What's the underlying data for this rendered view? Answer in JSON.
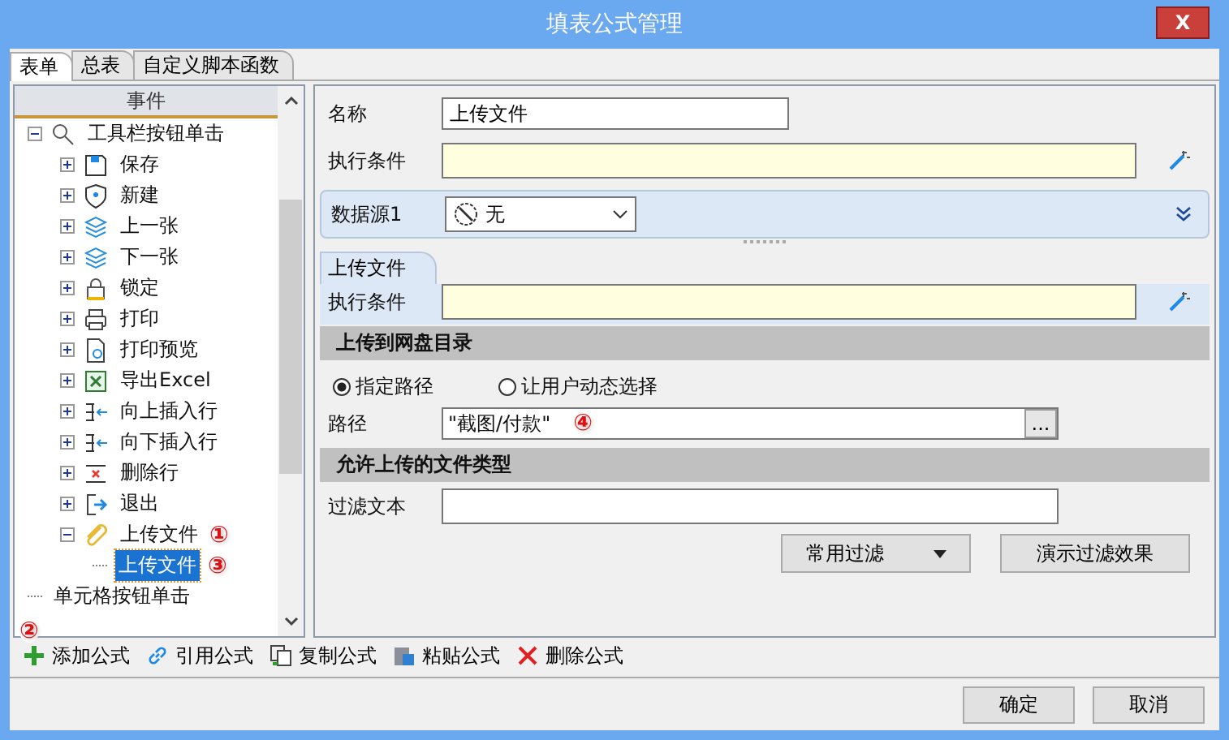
{
  "window": {
    "title": "填表公式管理",
    "close": "X"
  },
  "tabs": [
    {
      "label": "表单",
      "selected": true
    },
    {
      "label": "总表",
      "selected": false
    },
    {
      "label": "自定义脚本函数",
      "selected": false
    }
  ],
  "tree": {
    "header": "事件",
    "items": [
      {
        "label": "工具栏按钮单击",
        "expanded": true,
        "selected": false,
        "children": [
          {
            "label": "保存",
            "expanded": false,
            "selected": false
          },
          {
            "label": "新建",
            "expanded": false,
            "selected": false
          },
          {
            "label": "上一张",
            "expanded": false,
            "selected": false
          },
          {
            "label": "下一张",
            "expanded": false,
            "selected": false
          },
          {
            "label": "锁定",
            "expanded": false,
            "selected": false
          },
          {
            "label": "打印",
            "expanded": false,
            "selected": false
          },
          {
            "label": "打印预览",
            "expanded": false,
            "selected": false
          },
          {
            "label": "导出Excel",
            "expanded": false,
            "selected": false
          },
          {
            "label": "向上插入行",
            "expanded": false,
            "selected": false
          },
          {
            "label": "向下插入行",
            "expanded": false,
            "selected": false
          },
          {
            "label": "删除行",
            "expanded": false,
            "selected": false
          },
          {
            "label": "退出",
            "expanded": false,
            "selected": false
          },
          {
            "label": "上传文件",
            "expanded": true,
            "selected": false,
            "badge": "①",
            "children": [
              {
                "label": "上传文件",
                "selected": true,
                "badge": "③"
              }
            ]
          }
        ]
      },
      {
        "label": "单元格按钮单击",
        "selected": false
      }
    ]
  },
  "form": {
    "name_label": "名称",
    "name_value": "上传文件",
    "condition_label": "执行条件",
    "datasource": {
      "label": "数据源1",
      "value": "无"
    },
    "sub_tab": {
      "label": "上传文件",
      "condition_label": "执行条件"
    },
    "upload_section": {
      "title": "上传到网盘目录",
      "radios": [
        {
          "label": "指定路径",
          "selected": true
        },
        {
          "label": "让用户动态选择",
          "selected": false
        }
      ],
      "path_label": "路径",
      "path_value": "\"截图/付款\"",
      "path_badge": "④",
      "browse": "..."
    },
    "types_section": {
      "title": "允许上传的文件类型",
      "filter_label": "过滤文本",
      "buttons": [
        {
          "label": "常用过滤",
          "kind": "dropdown"
        },
        {
          "label": "演示过滤效果",
          "kind": "plain"
        }
      ]
    }
  },
  "toolbar": {
    "badge": "②",
    "buttons": [
      {
        "label": "添加公式"
      },
      {
        "label": "引用公式"
      },
      {
        "label": "复制公式"
      },
      {
        "label": "粘贴公式"
      },
      {
        "label": "删除公式"
      }
    ]
  },
  "footer": {
    "buttons": [
      "确定",
      "取消"
    ]
  }
}
